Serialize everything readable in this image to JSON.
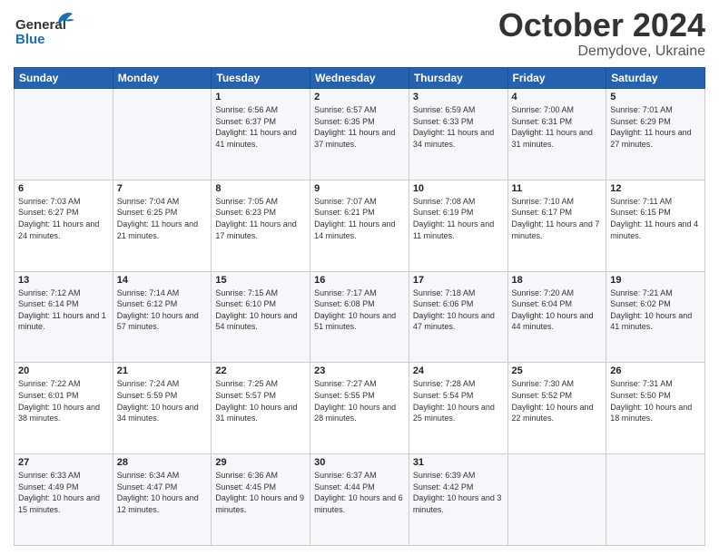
{
  "header": {
    "logo_general": "General",
    "logo_blue": "Blue",
    "month": "October 2024",
    "location": "Demydove, Ukraine"
  },
  "days": [
    "Sunday",
    "Monday",
    "Tuesday",
    "Wednesday",
    "Thursday",
    "Friday",
    "Saturday"
  ],
  "weeks": [
    [
      {
        "day": "",
        "info": ""
      },
      {
        "day": "",
        "info": ""
      },
      {
        "day": "1",
        "info": "Sunrise: 6:56 AM\nSunset: 6:37 PM\nDaylight: 11 hours and 41 minutes."
      },
      {
        "day": "2",
        "info": "Sunrise: 6:57 AM\nSunset: 6:35 PM\nDaylight: 11 hours and 37 minutes."
      },
      {
        "day": "3",
        "info": "Sunrise: 6:59 AM\nSunset: 6:33 PM\nDaylight: 11 hours and 34 minutes."
      },
      {
        "day": "4",
        "info": "Sunrise: 7:00 AM\nSunset: 6:31 PM\nDaylight: 11 hours and 31 minutes."
      },
      {
        "day": "5",
        "info": "Sunrise: 7:01 AM\nSunset: 6:29 PM\nDaylight: 11 hours and 27 minutes."
      }
    ],
    [
      {
        "day": "6",
        "info": "Sunrise: 7:03 AM\nSunset: 6:27 PM\nDaylight: 11 hours and 24 minutes."
      },
      {
        "day": "7",
        "info": "Sunrise: 7:04 AM\nSunset: 6:25 PM\nDaylight: 11 hours and 21 minutes."
      },
      {
        "day": "8",
        "info": "Sunrise: 7:05 AM\nSunset: 6:23 PM\nDaylight: 11 hours and 17 minutes."
      },
      {
        "day": "9",
        "info": "Sunrise: 7:07 AM\nSunset: 6:21 PM\nDaylight: 11 hours and 14 minutes."
      },
      {
        "day": "10",
        "info": "Sunrise: 7:08 AM\nSunset: 6:19 PM\nDaylight: 11 hours and 11 minutes."
      },
      {
        "day": "11",
        "info": "Sunrise: 7:10 AM\nSunset: 6:17 PM\nDaylight: 11 hours and 7 minutes."
      },
      {
        "day": "12",
        "info": "Sunrise: 7:11 AM\nSunset: 6:15 PM\nDaylight: 11 hours and 4 minutes."
      }
    ],
    [
      {
        "day": "13",
        "info": "Sunrise: 7:12 AM\nSunset: 6:14 PM\nDaylight: 11 hours and 1 minute."
      },
      {
        "day": "14",
        "info": "Sunrise: 7:14 AM\nSunset: 6:12 PM\nDaylight: 10 hours and 57 minutes."
      },
      {
        "day": "15",
        "info": "Sunrise: 7:15 AM\nSunset: 6:10 PM\nDaylight: 10 hours and 54 minutes."
      },
      {
        "day": "16",
        "info": "Sunrise: 7:17 AM\nSunset: 6:08 PM\nDaylight: 10 hours and 51 minutes."
      },
      {
        "day": "17",
        "info": "Sunrise: 7:18 AM\nSunset: 6:06 PM\nDaylight: 10 hours and 47 minutes."
      },
      {
        "day": "18",
        "info": "Sunrise: 7:20 AM\nSunset: 6:04 PM\nDaylight: 10 hours and 44 minutes."
      },
      {
        "day": "19",
        "info": "Sunrise: 7:21 AM\nSunset: 6:02 PM\nDaylight: 10 hours and 41 minutes."
      }
    ],
    [
      {
        "day": "20",
        "info": "Sunrise: 7:22 AM\nSunset: 6:01 PM\nDaylight: 10 hours and 38 minutes."
      },
      {
        "day": "21",
        "info": "Sunrise: 7:24 AM\nSunset: 5:59 PM\nDaylight: 10 hours and 34 minutes."
      },
      {
        "day": "22",
        "info": "Sunrise: 7:25 AM\nSunset: 5:57 PM\nDaylight: 10 hours and 31 minutes."
      },
      {
        "day": "23",
        "info": "Sunrise: 7:27 AM\nSunset: 5:55 PM\nDaylight: 10 hours and 28 minutes."
      },
      {
        "day": "24",
        "info": "Sunrise: 7:28 AM\nSunset: 5:54 PM\nDaylight: 10 hours and 25 minutes."
      },
      {
        "day": "25",
        "info": "Sunrise: 7:30 AM\nSunset: 5:52 PM\nDaylight: 10 hours and 22 minutes."
      },
      {
        "day": "26",
        "info": "Sunrise: 7:31 AM\nSunset: 5:50 PM\nDaylight: 10 hours and 18 minutes."
      }
    ],
    [
      {
        "day": "27",
        "info": "Sunrise: 6:33 AM\nSunset: 4:49 PM\nDaylight: 10 hours and 15 minutes."
      },
      {
        "day": "28",
        "info": "Sunrise: 6:34 AM\nSunset: 4:47 PM\nDaylight: 10 hours and 12 minutes."
      },
      {
        "day": "29",
        "info": "Sunrise: 6:36 AM\nSunset: 4:45 PM\nDaylight: 10 hours and 9 minutes."
      },
      {
        "day": "30",
        "info": "Sunrise: 6:37 AM\nSunset: 4:44 PM\nDaylight: 10 hours and 6 minutes."
      },
      {
        "day": "31",
        "info": "Sunrise: 6:39 AM\nSunset: 4:42 PM\nDaylight: 10 hours and 3 minutes."
      },
      {
        "day": "",
        "info": ""
      },
      {
        "day": "",
        "info": ""
      }
    ]
  ]
}
